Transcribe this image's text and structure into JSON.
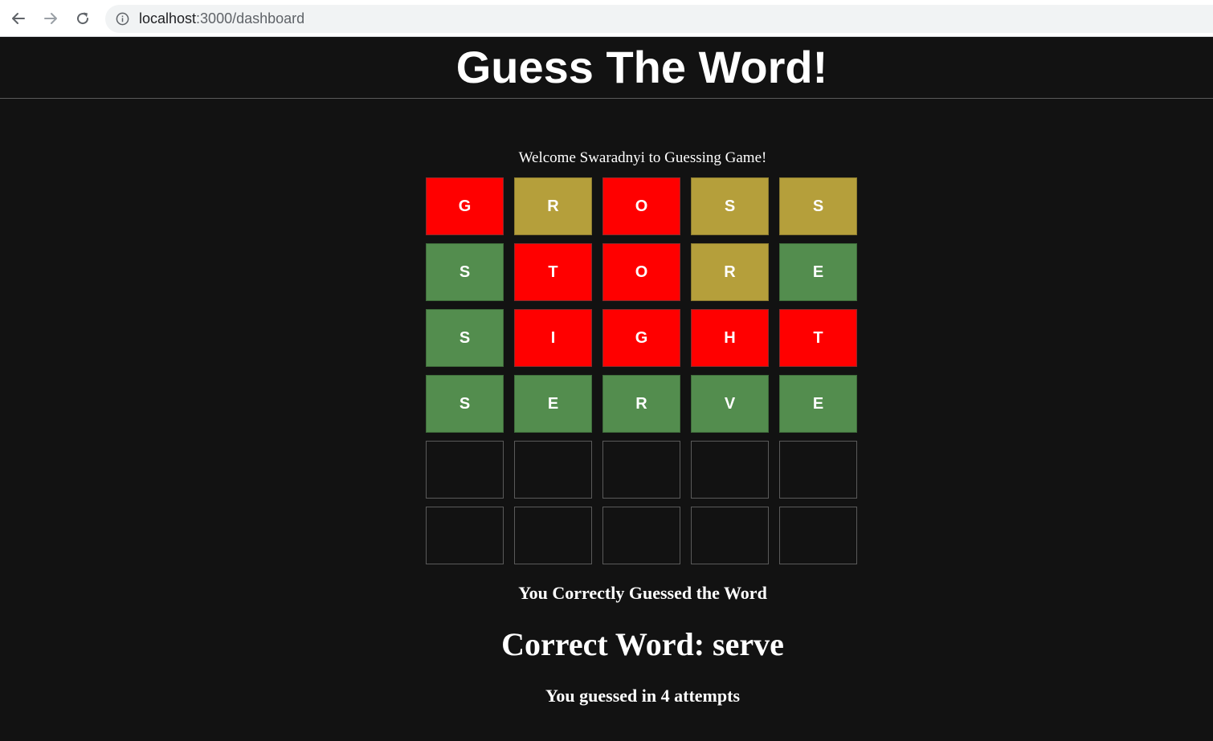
{
  "browser": {
    "url_host": "localhost",
    "url_path": ":3000/dashboard",
    "icons": {
      "back": "back-arrow-icon",
      "forward": "forward-arrow-icon",
      "reload": "reload-icon",
      "info": "info-icon"
    }
  },
  "header": {
    "title": "Guess The Word!"
  },
  "welcome_text": "Welcome Swaradnyi to Guessing Game!",
  "board": {
    "rows": [
      [
        {
          "letter": "G",
          "state": "absent"
        },
        {
          "letter": "R",
          "state": "present"
        },
        {
          "letter": "O",
          "state": "absent"
        },
        {
          "letter": "S",
          "state": "present"
        },
        {
          "letter": "S",
          "state": "present"
        }
      ],
      [
        {
          "letter": "S",
          "state": "correct"
        },
        {
          "letter": "T",
          "state": "absent"
        },
        {
          "letter": "O",
          "state": "absent"
        },
        {
          "letter": "R",
          "state": "present"
        },
        {
          "letter": "E",
          "state": "correct"
        }
      ],
      [
        {
          "letter": "S",
          "state": "correct"
        },
        {
          "letter": "I",
          "state": "absent"
        },
        {
          "letter": "G",
          "state": "absent"
        },
        {
          "letter": "H",
          "state": "absent"
        },
        {
          "letter": "T",
          "state": "absent"
        }
      ],
      [
        {
          "letter": "S",
          "state": "correct"
        },
        {
          "letter": "E",
          "state": "correct"
        },
        {
          "letter": "R",
          "state": "correct"
        },
        {
          "letter": "V",
          "state": "correct"
        },
        {
          "letter": "E",
          "state": "correct"
        }
      ],
      [
        {
          "letter": "",
          "state": "empty"
        },
        {
          "letter": "",
          "state": "empty"
        },
        {
          "letter": "",
          "state": "empty"
        },
        {
          "letter": "",
          "state": "empty"
        },
        {
          "letter": "",
          "state": "empty"
        }
      ],
      [
        {
          "letter": "",
          "state": "empty"
        },
        {
          "letter": "",
          "state": "empty"
        },
        {
          "letter": "",
          "state": "empty"
        },
        {
          "letter": "",
          "state": "empty"
        },
        {
          "letter": "",
          "state": "empty"
        }
      ]
    ],
    "colors": {
      "absent": "#ff0000",
      "present": "#b59f3b",
      "correct": "#538d4e",
      "empty": "#121212"
    }
  },
  "result": {
    "message": "You Correctly Guessed the Word",
    "correct_word": "Correct Word: serve",
    "attempts": "You guessed in 4 attempts"
  }
}
